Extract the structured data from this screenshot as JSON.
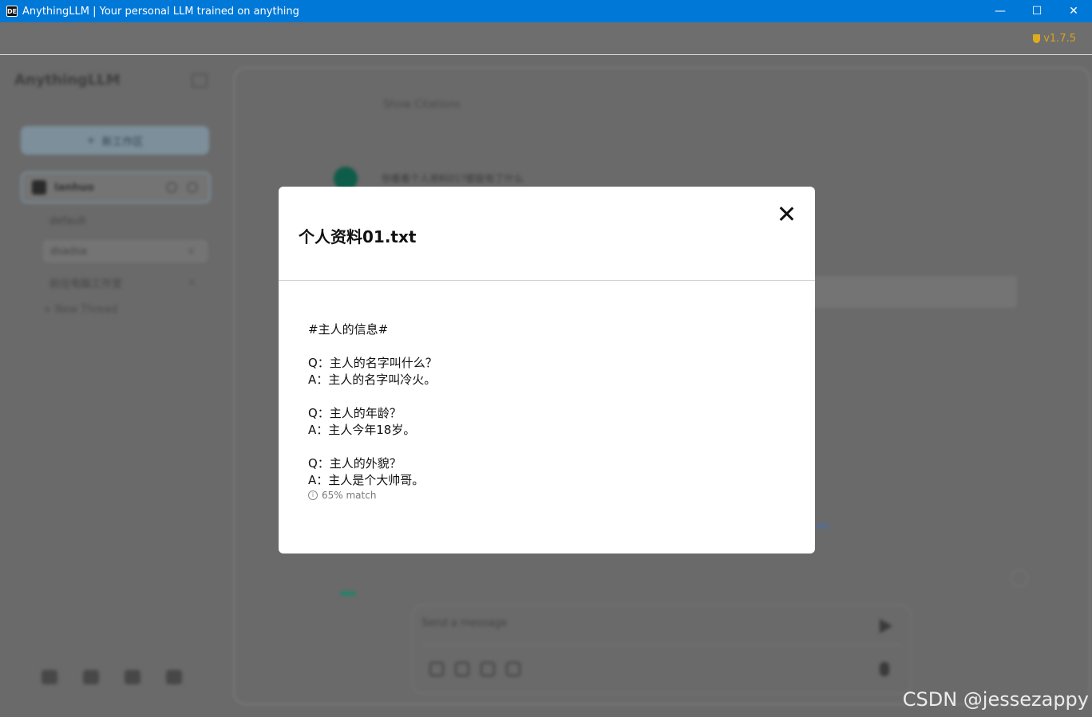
{
  "window": {
    "icon_label": "DE",
    "title": "AnythingLLM | Your personal LLM trained on anything",
    "controls": {
      "minimize": "—",
      "maximize": "☐",
      "close": "✕"
    }
  },
  "version_badge": "v1.7.5",
  "sidebar": {
    "logo": "AnythingLLM",
    "new_workspace_label": "新工作区",
    "workspace": {
      "name": "lanhuo"
    },
    "threads": [
      {
        "label": "default"
      },
      {
        "label": "dsadsa"
      },
      {
        "label": "前往电脑工作室"
      }
    ],
    "new_thread_label": "New Thread"
  },
  "chat": {
    "show_citations": "Show Citations",
    "user_message": "你看看个人资料01?都能有了什么",
    "input_placeholder": "Send a message"
  },
  "modal": {
    "title": "个人资料01.txt",
    "lines": [
      "#主人的信息#",
      "",
      "Q：主人的名字叫什么？",
      "A：主人的名字叫冷火。",
      "",
      "Q：主人的年龄？",
      "A：主人今年18岁。",
      "",
      "Q：主人的外貌？",
      "A：主人是个大帅哥。"
    ],
    "match": "65% match",
    "info_icon": "i"
  },
  "watermark": "CSDN @jessezappy"
}
